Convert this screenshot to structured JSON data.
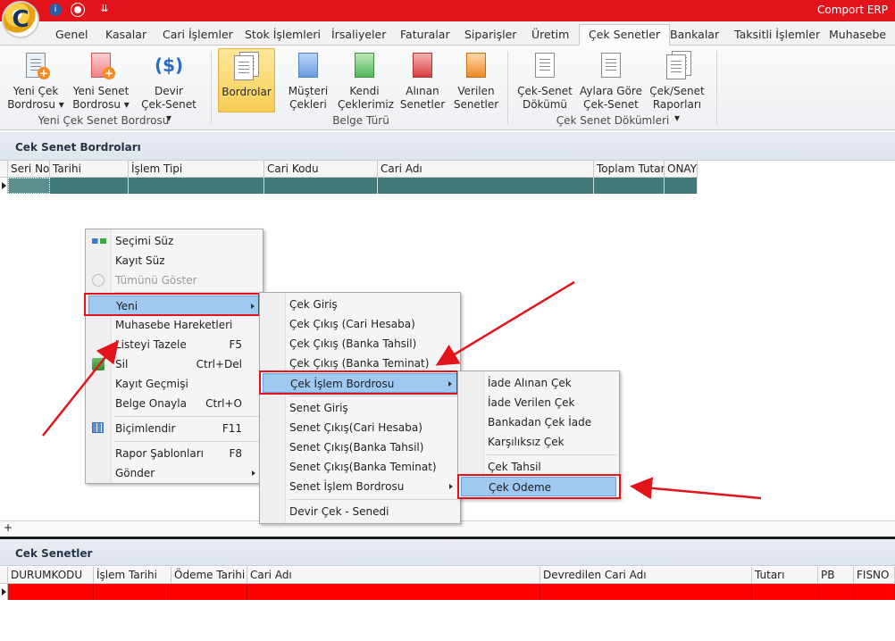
{
  "app": {
    "title": "Comport ERP",
    "logo_letter": "C"
  },
  "tabs": [
    {
      "label": "Genel"
    },
    {
      "label": "Kasalar"
    },
    {
      "label": "Cari İşlemler"
    },
    {
      "label": "Stok İşlemleri"
    },
    {
      "label": "İrsaliyeler"
    },
    {
      "label": "Faturalar"
    },
    {
      "label": "Siparişler"
    },
    {
      "label": "Üretim"
    },
    {
      "label": "Çek Senetler"
    },
    {
      "label": "Bankalar"
    },
    {
      "label": "Taksitli İşlemler"
    },
    {
      "label": "Muhasebe"
    }
  ],
  "ribbon": {
    "groups": [
      {
        "label": "Yeni Çek Senet Bordrosu"
      },
      {
        "label": "Belge Türü"
      },
      {
        "label": "Çek Senet Dökümleri"
      }
    ],
    "buttons": [
      {
        "line1": "Yeni Çek",
        "line2": "Bordrosu ▾"
      },
      {
        "line1": "Yeni Senet",
        "line2": "Bordrosu ▾"
      },
      {
        "line1": "Devir",
        "line2": "Çek-Senet ▾"
      },
      {
        "line1": "Bordrolar",
        "line2": ""
      },
      {
        "line1": "Müşteri",
        "line2": "Çekleri"
      },
      {
        "line1": "Kendi",
        "line2": "Çeklerimiz"
      },
      {
        "line1": "Alınan",
        "line2": "Senetler"
      },
      {
        "line1": "Verilen",
        "line2": "Senetler"
      },
      {
        "line1": "Çek-Senet",
        "line2": "Dökümü"
      },
      {
        "line1": "Aylara Göre",
        "line2": "Çek-Senet"
      },
      {
        "line1": "Çek/Senet",
        "line2": "Raporları ▾"
      }
    ]
  },
  "top_panel": {
    "title": "Cek Senet Bordroları",
    "columns": [
      "Seri No",
      "Tarihi",
      "İşlem Tipi",
      "Cari Kodu",
      "Cari Adı",
      "Toplam Tutar",
      "ONAY"
    ]
  },
  "bottom_panel": {
    "title": "Cek Senetler",
    "columns": [
      "DURUMKODU",
      "İşlem Tarihi",
      "Ödeme Tarihi",
      "Cari Adı",
      "Devredilen Cari Adı",
      "Tutarı",
      "PB",
      "FISNO"
    ]
  },
  "menu1": {
    "items": [
      {
        "label": "Seçimi Süz",
        "shortcut": ""
      },
      {
        "label": "Kayıt Süz",
        "shortcut": ""
      },
      {
        "label": "Tümünü Göster",
        "shortcut": ""
      },
      {
        "label": "Yeni",
        "shortcut": ""
      },
      {
        "label": "Muhasebe Hareketleri",
        "shortcut": ""
      },
      {
        "label": "Listeyi Tazele",
        "shortcut": "F5"
      },
      {
        "label": "Sil",
        "shortcut": "Ctrl+Del"
      },
      {
        "label": "Kayıt Geçmişi",
        "shortcut": ""
      },
      {
        "label": "Belge Onayla",
        "shortcut": "Ctrl+O"
      },
      {
        "label": "Biçimlendir",
        "shortcut": "F11"
      },
      {
        "label": "Rapor Şablonları",
        "shortcut": "F8"
      },
      {
        "label": "Gönder",
        "shortcut": ""
      }
    ]
  },
  "menu2": {
    "items": [
      {
        "label": "Çek Giriş"
      },
      {
        "label": "Çek Çıkış (Cari Hesaba)"
      },
      {
        "label": "Çek Çıkış (Banka Tahsil)"
      },
      {
        "label": "Çek Çıkış (Banka Teminat)"
      },
      {
        "label": "Çek İşlem Bordrosu"
      },
      {
        "label": "Senet Giriş"
      },
      {
        "label": "Senet Çıkış(Cari Hesaba)"
      },
      {
        "label": "Senet Çıkış(Banka Tahsil)"
      },
      {
        "label": "Senet Çıkış(Banka Teminat)"
      },
      {
        "label": "Senet İşlem Bordrosu"
      },
      {
        "label": "Devir Çek - Senedi"
      }
    ]
  },
  "menu3": {
    "items": [
      {
        "label": "İade Alınan Çek"
      },
      {
        "label": "İade Verilen Çek"
      },
      {
        "label": "Bankadan Çek İade"
      },
      {
        "label": "Karşılıksız Çek"
      },
      {
        "label": "Çek Tahsil"
      },
      {
        "label": "Çek Odeme"
      }
    ]
  },
  "colors": {
    "title_bar": "#e3131c",
    "top_row": "#3f7a78",
    "bottom_row": "#ff0000",
    "highlight": "#9fc9f1",
    "annotation": "#e3131c"
  }
}
